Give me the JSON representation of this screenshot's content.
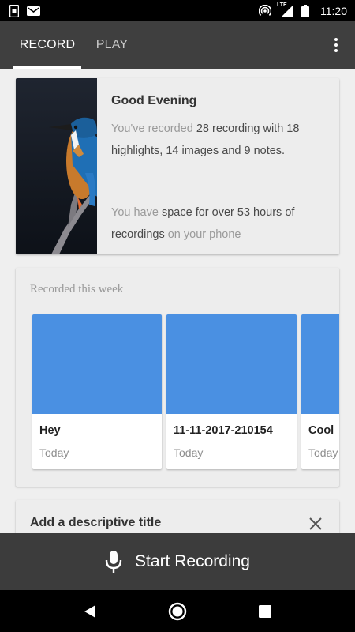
{
  "status_bar": {
    "time": "11:20",
    "network_label": "LTE",
    "icons": [
      "sim-card-icon",
      "mail-icon",
      "hotspot-icon",
      "signal-icon",
      "battery-icon"
    ]
  },
  "tabs": [
    {
      "label": "RECORD",
      "active": true
    },
    {
      "label": "PLAY",
      "active": false
    }
  ],
  "greeting": {
    "title": "Good Evening",
    "recorded_prefix": "You've recorded ",
    "recorded_highlight": "28 recording with 18 highlights, 14 images and 9 notes.",
    "space_prefix": "You have ",
    "space_highlight": "space for over 53 hours of recordings",
    "space_suffix": " on your phone"
  },
  "week": {
    "title": "Recorded this week",
    "recordings": [
      {
        "name": "Hey",
        "date": "Today"
      },
      {
        "name": "11-11-2017-210154",
        "date": "Today"
      },
      {
        "name": "Cool",
        "date": "Today"
      }
    ]
  },
  "title_prompt": {
    "label": "Add a descriptive title"
  },
  "record_button": {
    "label": "Start Recording"
  },
  "colors": {
    "accent": "#4a90e2",
    "app_bar": "#3f3f3f",
    "record_bar": "#3c3c3c"
  }
}
